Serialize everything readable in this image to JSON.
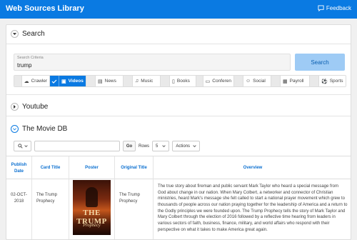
{
  "header": {
    "title": "Web Sources Library",
    "feedback": "Feedback"
  },
  "search": {
    "heading": "Search",
    "field_label": "Search Criteria",
    "field_value": "trump",
    "button": "Search",
    "filters": [
      {
        "label": "Crawler",
        "icon": "cloud-icon",
        "selected": false
      },
      {
        "label": "Videos",
        "icon": "video-icon",
        "selected": true
      },
      {
        "label": "News",
        "icon": "newspaper-icon",
        "selected": false
      },
      {
        "label": "Music",
        "icon": "music-note-icon",
        "selected": false
      },
      {
        "label": "Books",
        "icon": "book-icon",
        "selected": false
      },
      {
        "label": "Conferen",
        "icon": "conference-icon",
        "selected": false
      },
      {
        "label": "Social",
        "icon": "people-icon",
        "selected": false
      },
      {
        "label": "Payroll",
        "icon": "payroll-icon",
        "selected": false
      },
      {
        "label": "Sports",
        "icon": "soccer-ball-icon",
        "selected": false
      }
    ]
  },
  "youtube": {
    "heading": "Youtube"
  },
  "moviedb": {
    "heading": "The Movie DB",
    "toolbar": {
      "go": "Go",
      "rows_label": "Rows",
      "rows_value": "5",
      "actions": "Actions"
    },
    "columns": [
      "Publish Date",
      "Card Title",
      "Poster",
      "Original Title",
      "Overview"
    ],
    "row": {
      "publish_date": "02-OCT-2018",
      "card_title": "The Trump Prophecy",
      "poster_title": "THE TRUMP",
      "poster_subtitle": "Prophecy",
      "original_title": "The Trump Prophecy",
      "overview": "The true story about fireman and public servant Mark Taylor who heard a special message from God about change in our nation. When Mary Colbert, a networker and connector of Christian ministries, heard Mark's message she felt called to start a national prayer movement which grew to thousands of people across our nation praying together for the leadership of America and a return to the Godly principles we were founded upon. The Trump Prophecy tells the story of Mark Taylor and Mary Colbert through the election of 2016 followed by a reflective time hearing from leaders in various sectors of faith, business, finance, military, and world affairs who respond with their perspective on what it takes to make America great again."
    }
  },
  "colors": {
    "accent": "#0a7ae2",
    "search_button": "#9ecbf5",
    "link_header": "#0a6fd0"
  }
}
